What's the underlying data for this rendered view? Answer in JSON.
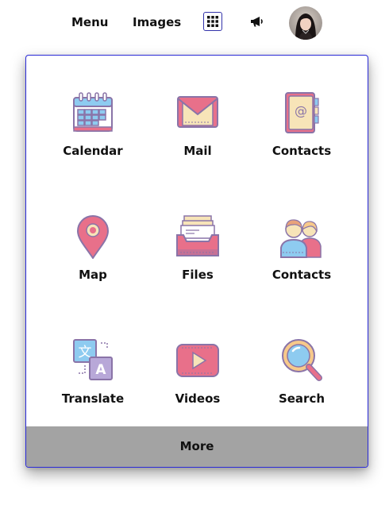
{
  "topbar": {
    "menu_label": "Menu",
    "images_label": "Images",
    "apps_icon": "grid-icon",
    "notifications_icon": "megaphone-icon"
  },
  "apps": [
    {
      "label": "Calendar",
      "icon": "calendar-icon"
    },
    {
      "label": "Mail",
      "icon": "mail-icon"
    },
    {
      "label": "Contacts",
      "icon": "address-book-icon"
    },
    {
      "label": "Map",
      "icon": "map-pin-icon"
    },
    {
      "label": "Files",
      "icon": "file-tray-icon"
    },
    {
      "label": "Contacts",
      "icon": "people-icon"
    },
    {
      "label": "Translate",
      "icon": "translate-icon"
    },
    {
      "label": "Videos",
      "icon": "video-play-icon"
    },
    {
      "label": "Search",
      "icon": "magnifier-icon"
    }
  ],
  "more_label": "More",
  "colors": {
    "panel_border": "#2b2bd8",
    "more_bar": "#a3a3a3",
    "icon_pink": "#e8708a",
    "icon_blue": "#8ecbf0",
    "icon_purple": "#8a74a8",
    "icon_cream": "#f7e4b8"
  }
}
